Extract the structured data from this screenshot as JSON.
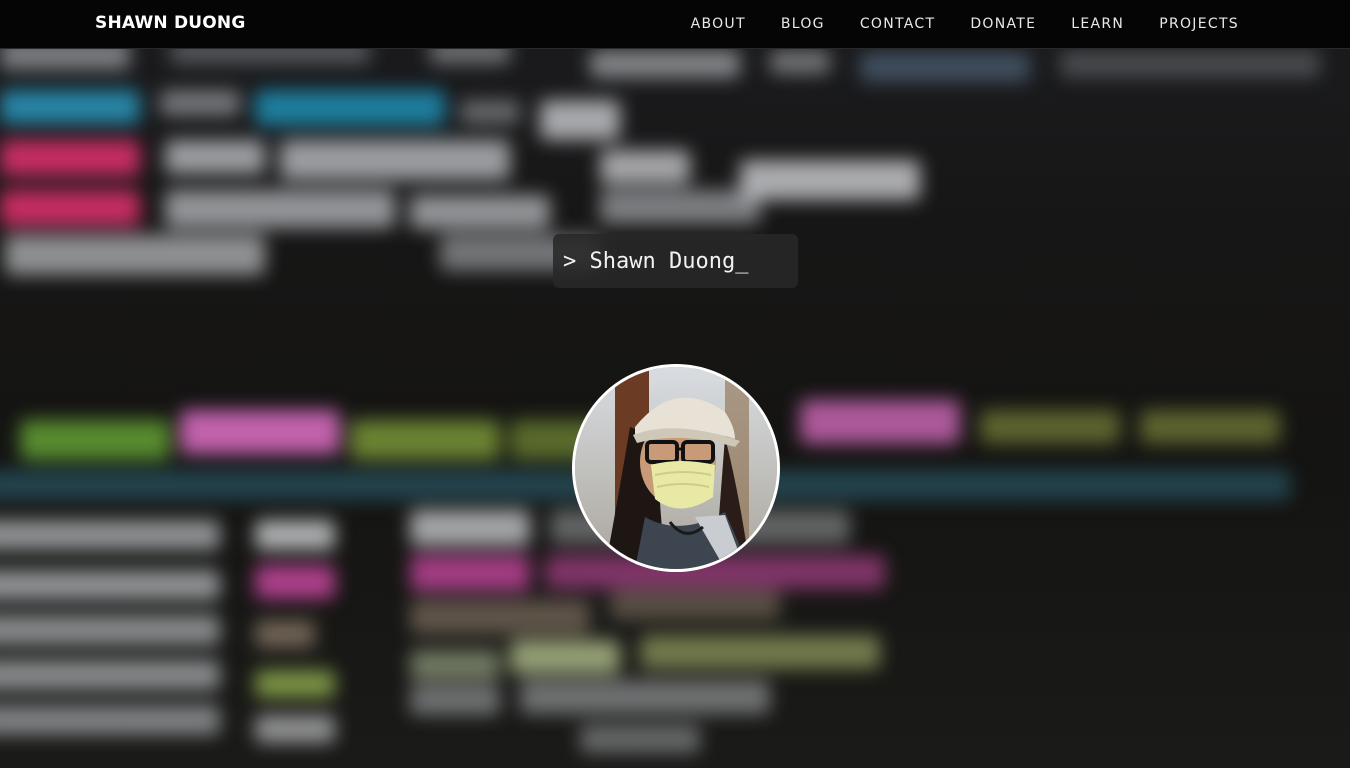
{
  "navbar": {
    "brand": "SHAWN DUONG",
    "links": [
      {
        "label": "ABOUT"
      },
      {
        "label": "BLOG"
      },
      {
        "label": "CONTACT"
      },
      {
        "label": "DONATE"
      },
      {
        "label": "LEARN"
      },
      {
        "label": "PROJECTS"
      }
    ]
  },
  "hero": {
    "terminal_prompt": ">",
    "terminal_text": "Shawn Duong_"
  },
  "colors": {
    "navbar_bg": "#050505",
    "text": "#ffffff",
    "terminal_bg": "#282828"
  }
}
